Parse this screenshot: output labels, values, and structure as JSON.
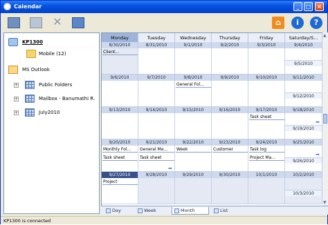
{
  "window": {
    "title": "Calendar"
  },
  "toolbar": {
    "left_icons": [
      "calendar-icon",
      "edit-icon",
      "delete-icon",
      "sync-icon"
    ],
    "right_icons": [
      "home-icon",
      "info-icon",
      "help-icon"
    ]
  },
  "tree": {
    "device": "KP1300",
    "mobile": "Mobile (12)",
    "outlook": "MS Outlook",
    "items": [
      "Public Folders",
      "Mailbox - Banumathi R.",
      "July2010"
    ]
  },
  "calendar": {
    "days": [
      "Monday",
      "Tuesday",
      "Wednesday",
      "Thursday",
      "Friday",
      "Saturday/S..."
    ],
    "weeks": [
      {
        "dates": [
          "8/30/2010",
          "8/31/2010",
          "9/1/2010",
          "9/2/2010",
          "9/3/2010",
          "9/4/2010"
        ],
        "sunday": "9/5/2010",
        "events": {
          "0": [
            "Client..."
          ]
        }
      },
      {
        "dates": [
          "9/6/2010",
          "9/7/2010",
          "9/8/2010",
          "9/9/2010",
          "9/10/2010",
          "9/11/2010"
        ],
        "sunday": "9/12/2010",
        "events": {
          "2": [
            "General Fol..."
          ]
        }
      },
      {
        "dates": [
          "9/13/2010",
          "9/14/2010",
          "9/15/2010",
          "9/16/2010",
          "9/17/2010",
          "9/18/2010"
        ],
        "sunday": "9/19/2010",
        "events": {
          "4": [
            "Task sheet"
          ]
        }
      },
      {
        "dates": [
          "9/20/2010",
          "9/21/2010",
          "9/22/2010",
          "9/23/2010",
          "9/24/2010",
          "9/25/2010"
        ],
        "sunday": "9/26/2010",
        "events": {
          "0": [
            "Monthly Fol...",
            "Task sheet"
          ],
          "1": [
            "General Me...",
            "Task sheet"
          ],
          "2": [
            "Week"
          ],
          "3": [
            "Customer"
          ],
          "4": [
            "Task log",
            "Project Ma..."
          ]
        }
      },
      {
        "dates": [
          "9/27/2010",
          "9/28/2010",
          "9/29/2010",
          "9/30/2010",
          "10/1/2010",
          "10/2/2010"
        ],
        "sunday": "10/3/2010",
        "events": {
          "0": [
            "Project"
          ]
        }
      }
    ]
  },
  "tabs": [
    "Day",
    "Week",
    "Month",
    "List"
  ],
  "active_tab": "Month",
  "status": "KP1300 is connected"
}
